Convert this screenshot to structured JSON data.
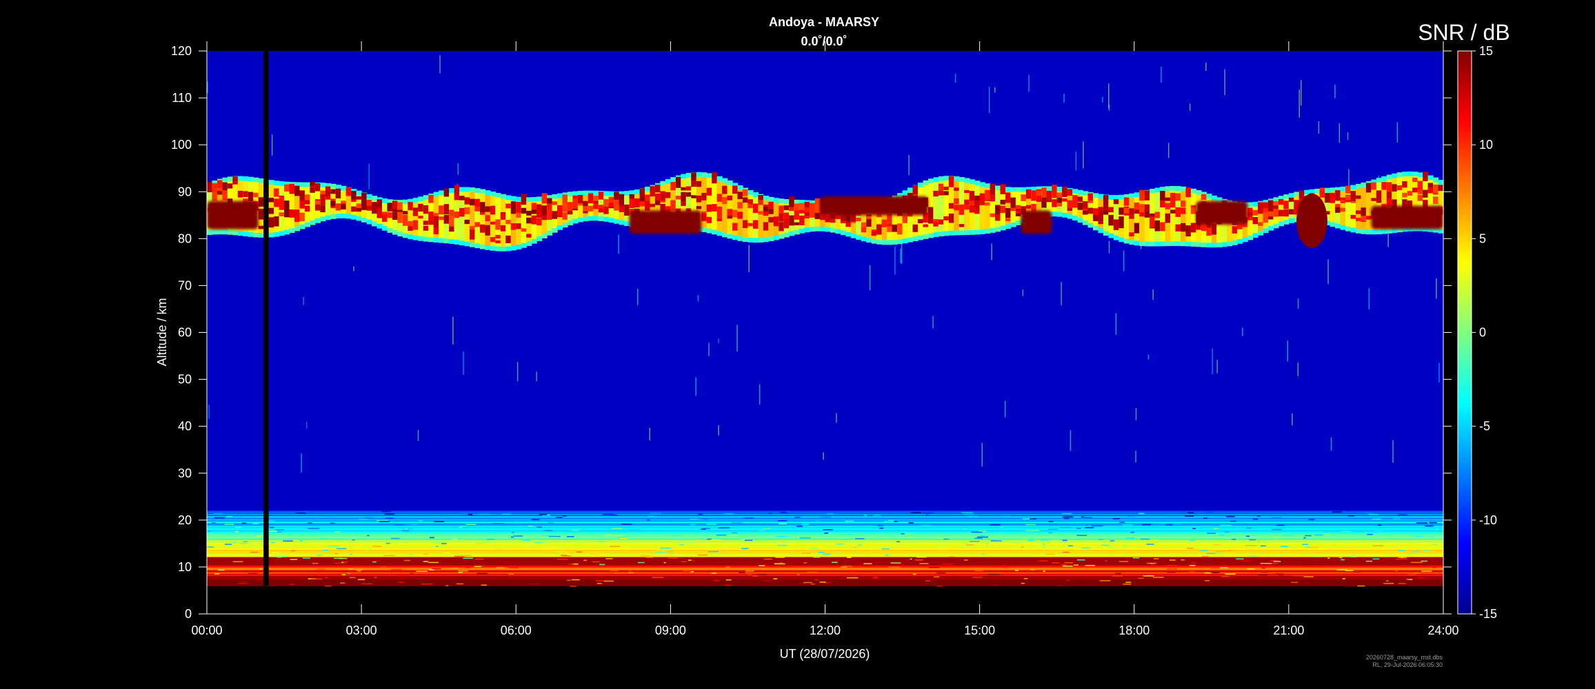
{
  "chart_data": {
    "type": "heatmap",
    "title": "Andoya - MAARSY",
    "subtitle": "0.0˚/0.0˚",
    "xlabel": "UT (28/07/2026)",
    "ylabel": "Altitude / km",
    "colorbar_label": "SNR / dB",
    "x_ticks": [
      "00:00",
      "03:00",
      "06:00",
      "09:00",
      "12:00",
      "15:00",
      "18:00",
      "21:00",
      "24:00"
    ],
    "xlim_hours": [
      0,
      24
    ],
    "y_ticks": [
      0,
      10,
      20,
      30,
      40,
      50,
      60,
      70,
      80,
      90,
      100,
      110,
      120
    ],
    "ylim_km": [
      0,
      120
    ],
    "colorbar_ticks": [
      -15,
      -10,
      -5,
      0,
      5,
      10,
      15
    ],
    "clim_db": [
      -15,
      15
    ],
    "colormap": "jet",
    "grid": false,
    "data_altitude_range_km": [
      6,
      120
    ],
    "background_snr_db": -13,
    "data_gap_hours": [
      1.1,
      1.2
    ],
    "echo_layers": [
      {
        "name": "PMSE",
        "altitude_km": [
          80,
          91
        ],
        "time_hours": [
          0,
          24
        ],
        "max_snr_db": 15
      },
      {
        "name": "lower troposphere",
        "altitude_km": [
          6,
          22
        ],
        "time_hours": [
          0,
          24
        ],
        "max_snr_db": 15
      }
    ],
    "strong_patches": [
      {
        "time_hours": [
          0.0,
          1.0
        ],
        "altitude_km": [
          82,
          88
        ]
      },
      {
        "time_hours": [
          8.2,
          9.6
        ],
        "altitude_km": [
          81,
          86
        ]
      },
      {
        "time_hours": [
          11.9,
          14.0
        ],
        "altitude_km": [
          85,
          89
        ]
      },
      {
        "time_hours": [
          15.8,
          16.4
        ],
        "altitude_km": [
          81,
          86
        ]
      },
      {
        "time_hours": [
          19.2,
          20.2
        ],
        "altitude_km": [
          83,
          88
        ]
      },
      {
        "time_hours": [
          21.2,
          21.6
        ],
        "altitude_km": [
          80,
          88
        ]
      },
      {
        "time_hours": [
          22.6,
          24.0
        ],
        "altitude_km": [
          82,
          87
        ]
      }
    ]
  },
  "footer": {
    "filename": "20260728_maarsy_mst.dbs",
    "stamp": "RL, 29-Jul-2026 06:05:30"
  }
}
